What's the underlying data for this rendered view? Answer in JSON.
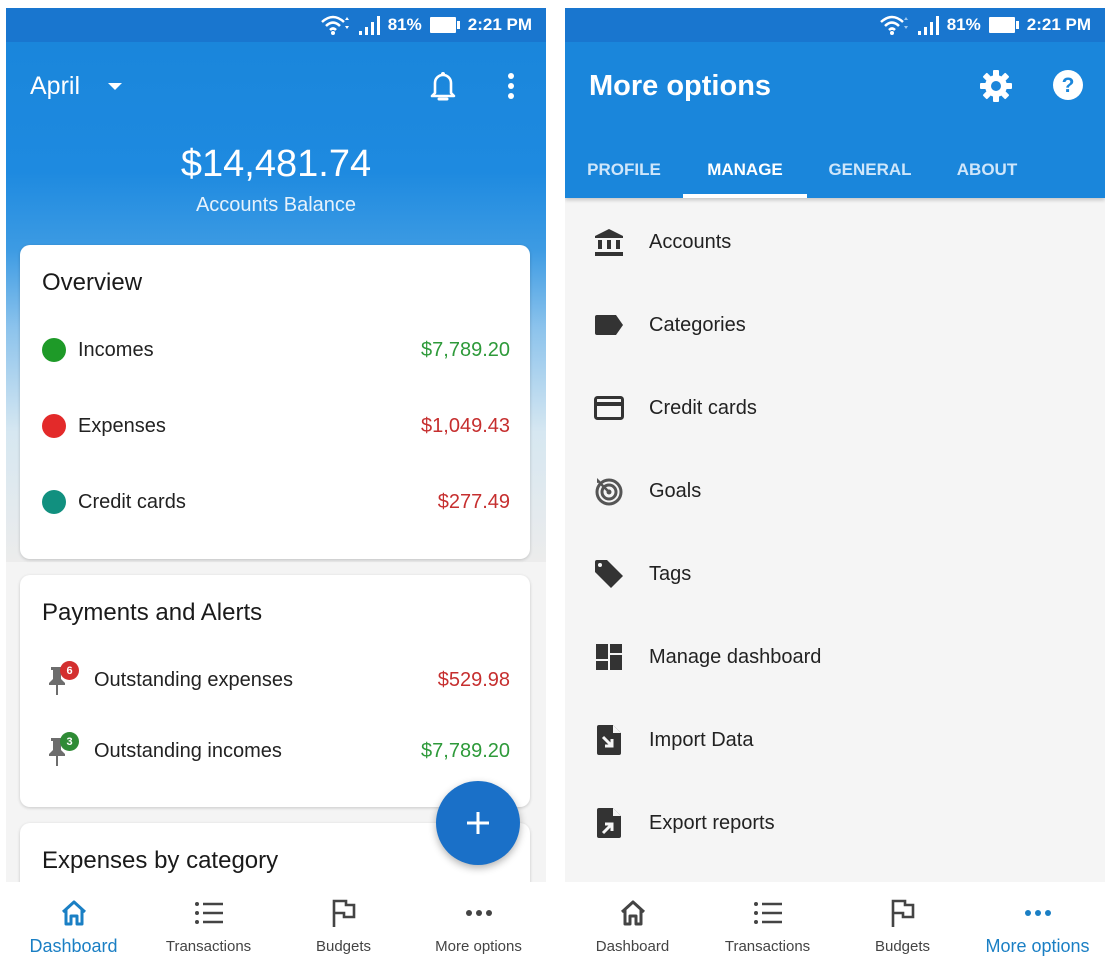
{
  "status_bar": {
    "battery": "81%",
    "time": "2:21 PM"
  },
  "dashboard": {
    "month": "April",
    "balance": "$14,481.74",
    "balance_label": "Accounts Balance",
    "overview": {
      "title": "Overview",
      "rows": [
        {
          "label": "Incomes",
          "amount": "$7,789.20",
          "dot_color": "#1e9a28",
          "amount_color": "#2e9a3a"
        },
        {
          "label": "Expenses",
          "amount": "$1,049.43",
          "dot_color": "#e32a2a",
          "amount_color": "#c62f2f"
        },
        {
          "label": "Credit cards",
          "amount": "$277.49",
          "dot_color": "#11907f",
          "amount_color": "#c62f2f"
        }
      ]
    },
    "payments": {
      "title": "Payments and Alerts",
      "rows": [
        {
          "label": "Outstanding expenses",
          "amount": "$529.98",
          "badge": "6",
          "badge_color": "#d32f2f",
          "amount_color": "#c62f2f"
        },
        {
          "label": "Outstanding incomes",
          "amount": "$7,789.20",
          "badge": "3",
          "badge_color": "#2e8b35",
          "amount_color": "#2e9a3a"
        }
      ]
    },
    "expenses_by_category": {
      "title": "Expenses by category"
    },
    "fab_icon": "plus-icon"
  },
  "more_options": {
    "title": "More options",
    "tabs": [
      {
        "label": "PROFILE",
        "active": false
      },
      {
        "label": "MANAGE",
        "active": true
      },
      {
        "label": "GENERAL",
        "active": false
      },
      {
        "label": "ABOUT",
        "active": false
      }
    ],
    "items": [
      {
        "label": "Accounts",
        "icon": "bank-icon"
      },
      {
        "label": "Categories",
        "icon": "label-icon"
      },
      {
        "label": "Credit cards",
        "icon": "credit-card-icon"
      },
      {
        "label": "Goals",
        "icon": "target-icon"
      },
      {
        "label": "Tags",
        "icon": "tag-icon"
      },
      {
        "label": "Manage dashboard",
        "icon": "dashboard-grid-icon"
      },
      {
        "label": "Import Data",
        "icon": "file-import-icon"
      },
      {
        "label": "Export reports",
        "icon": "file-export-icon"
      }
    ]
  },
  "bottom_nav": {
    "items": [
      {
        "label": "Dashboard",
        "icon": "home-icon"
      },
      {
        "label": "Transactions",
        "icon": "list-icon"
      },
      {
        "label": "Budgets",
        "icon": "flag-icon"
      },
      {
        "label": "More options",
        "icon": "more-horizontal-icon"
      }
    ],
    "left_active": "Dashboard",
    "right_active": "More options",
    "active_color": "#1a7fc4"
  }
}
